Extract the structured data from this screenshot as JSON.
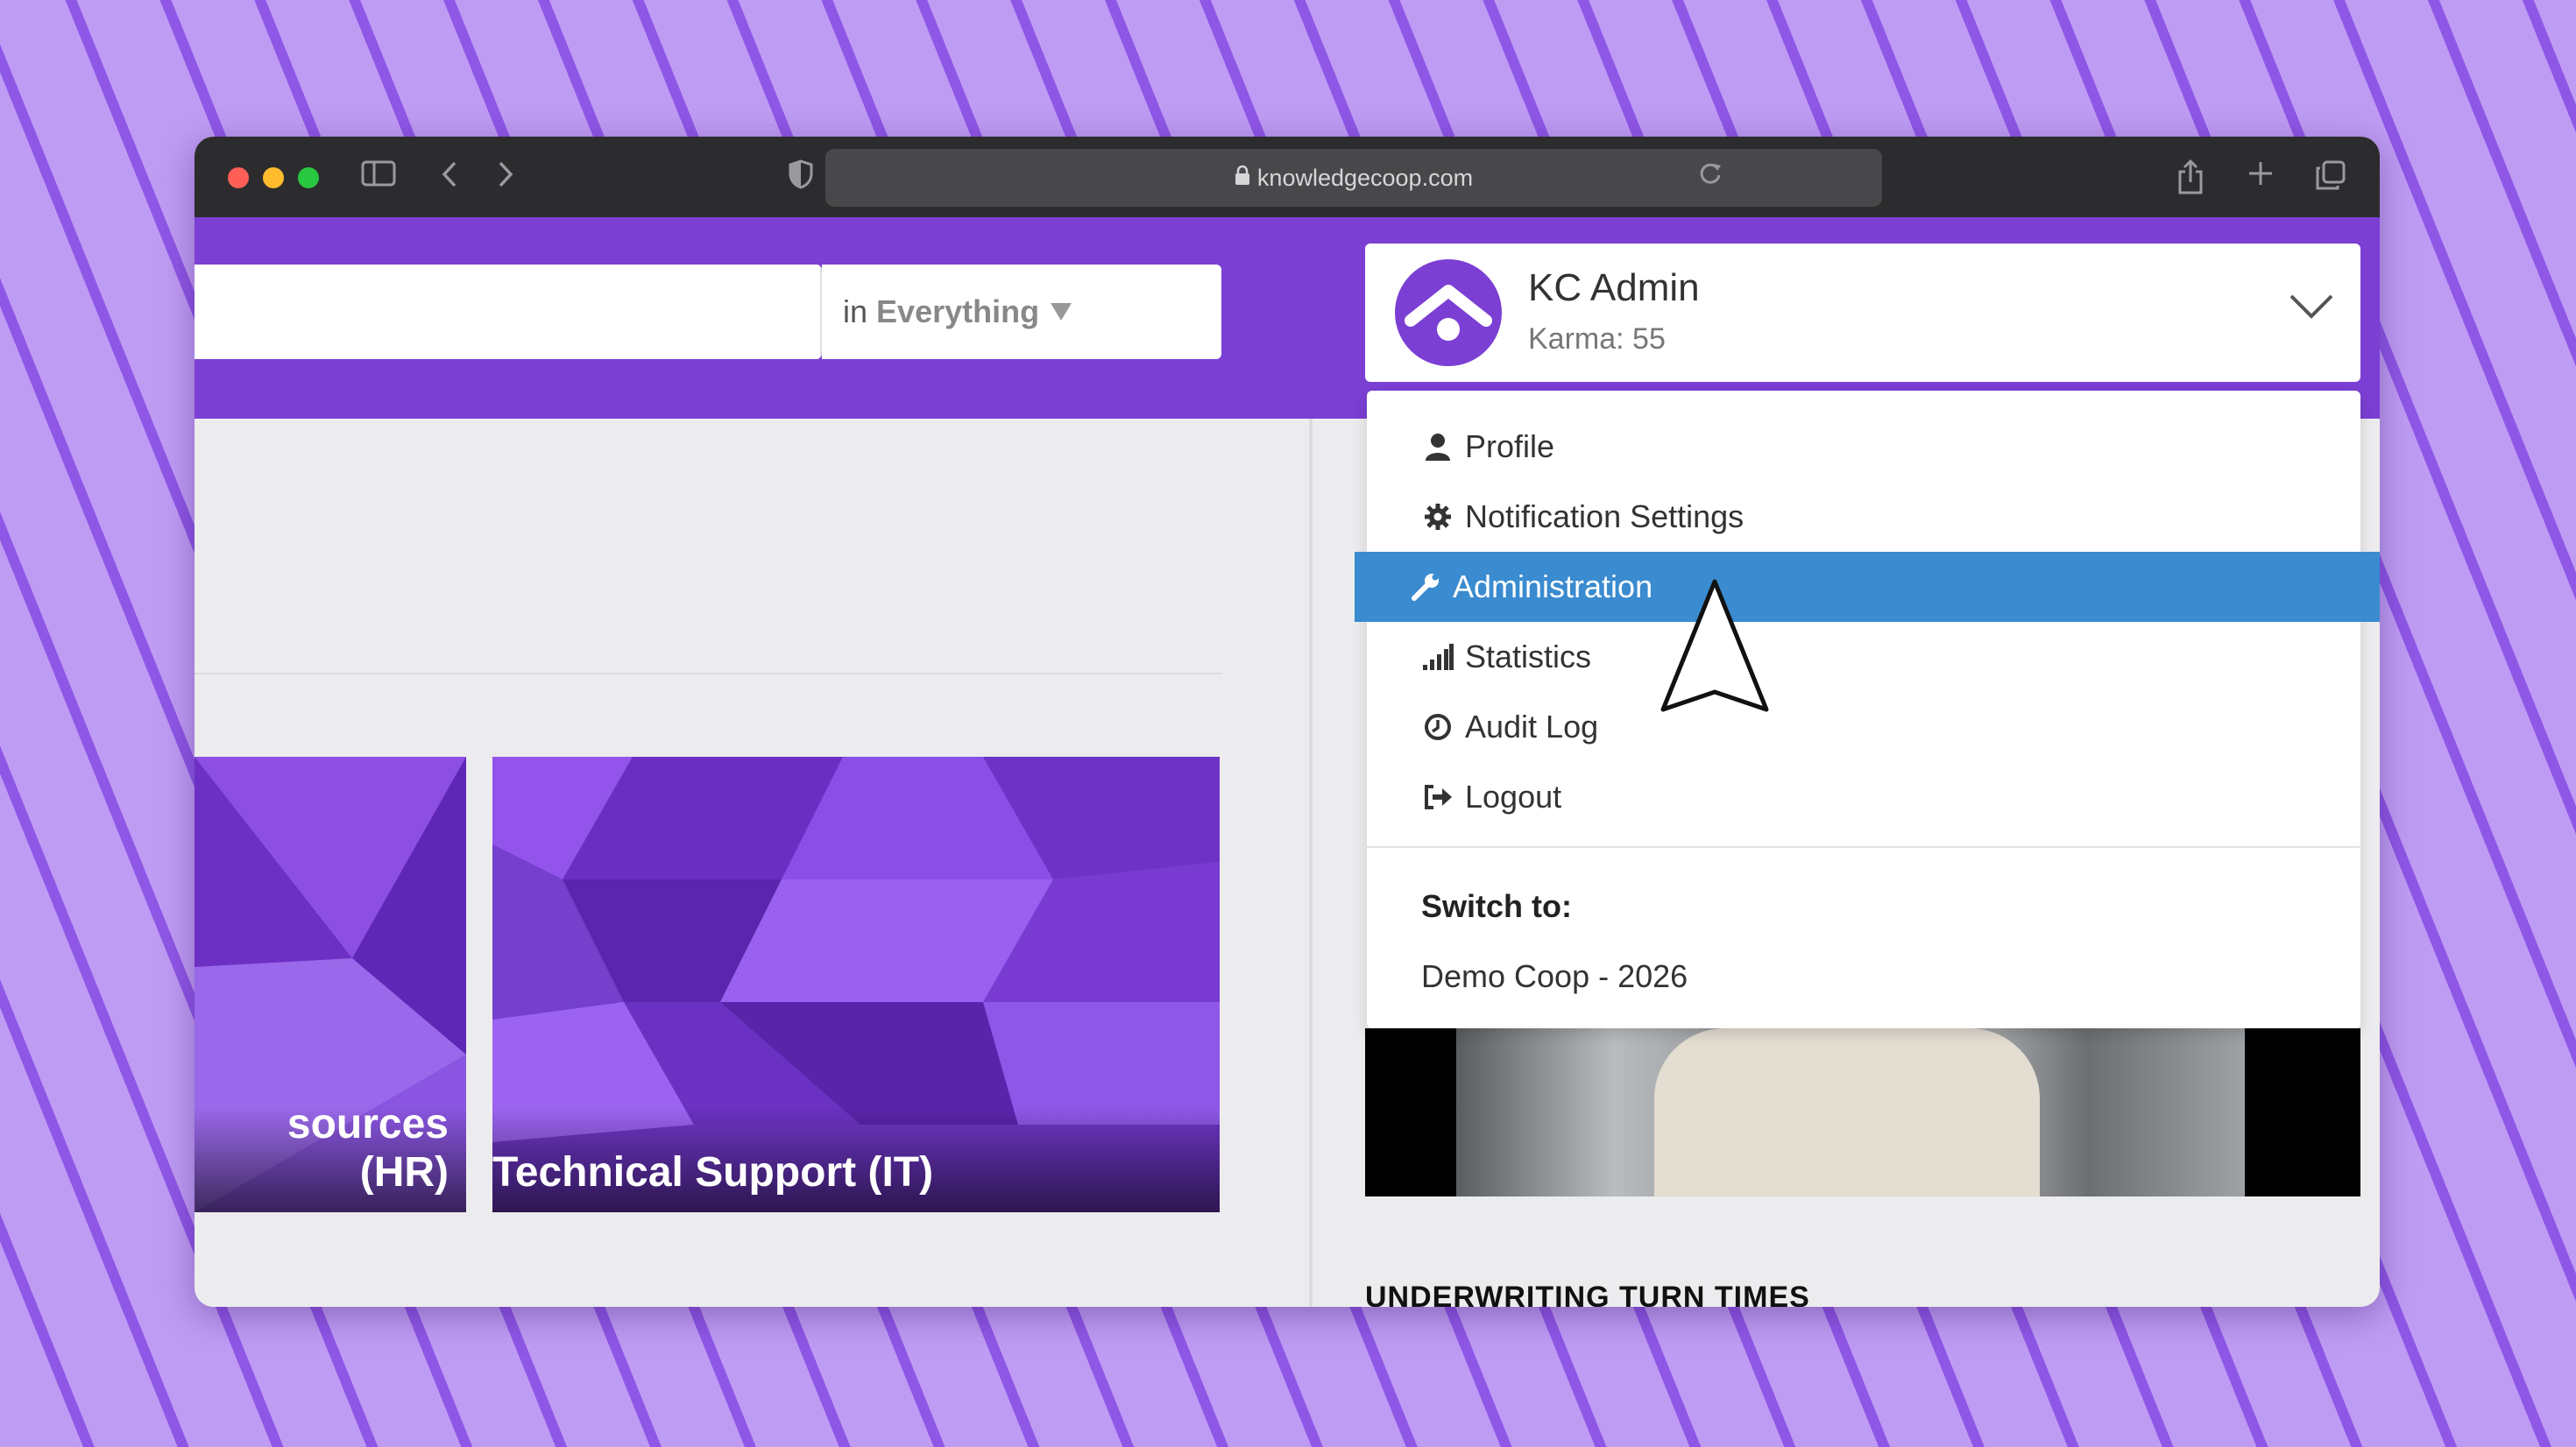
{
  "browser": {
    "url": "knowledgecoop.com",
    "traffic_colors": [
      "#ff5f57",
      "#febc2e",
      "#28c840"
    ]
  },
  "search": {
    "scope_prefix": "in",
    "scope_value": "Everything"
  },
  "tiles": [
    {
      "caption": "sources (HR)"
    },
    {
      "caption": "Technical Support (IT)"
    }
  ],
  "user": {
    "name": "KC Admin",
    "karma": "Karma: 55"
  },
  "menu": {
    "items": [
      {
        "label": "Profile",
        "icon": "user-icon"
      },
      {
        "label": "Notification Settings",
        "icon": "gear-icon"
      },
      {
        "label": "Administration",
        "icon": "wrench-icon"
      },
      {
        "label": "Statistics",
        "icon": "signal-bars-icon"
      },
      {
        "label": "Audit Log",
        "icon": "clock-icon"
      },
      {
        "label": "Logout",
        "icon": "sign-out-icon"
      }
    ],
    "switch_label": "Switch to:",
    "coop": "Demo Coop - 2026"
  },
  "section_title": "UNDERWRITING TURN TIMES",
  "colors": {
    "brand_purple": "#7b3fd4",
    "active_blue": "#3a8bd0"
  }
}
